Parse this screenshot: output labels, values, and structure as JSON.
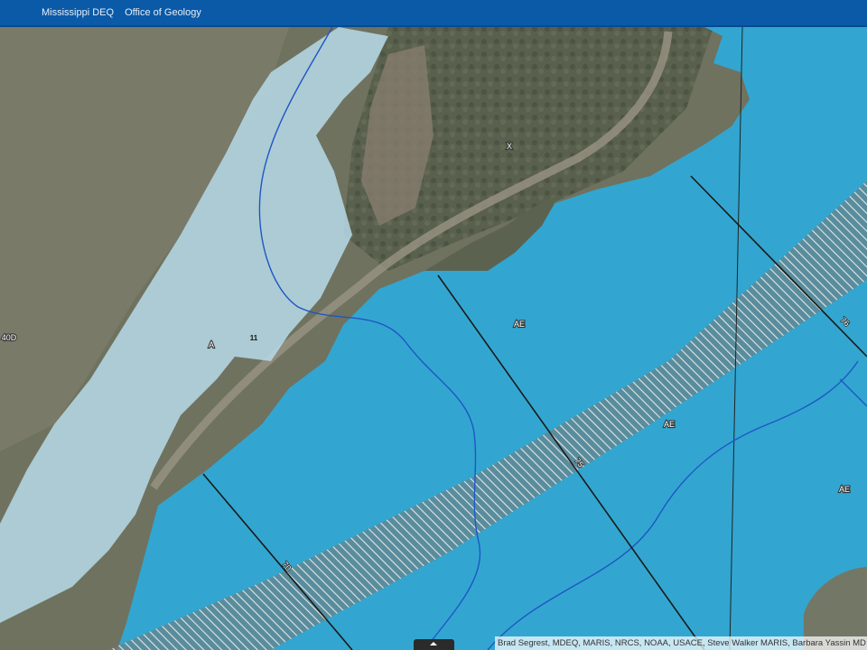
{
  "header": {
    "org_link": "Mississippi DEQ",
    "office_link": "Office of Geology"
  },
  "map": {
    "zone_labels": {
      "x": "X",
      "ae_center": "AE",
      "ae_band": "AE",
      "ae_right": "AE",
      "a_zone": "A"
    },
    "contour_label": "11",
    "left_edge_label": "40D",
    "section_labels": {
      "line_1": "70",
      "line_2": "75",
      "line_3": "76"
    },
    "colors": {
      "floodway_ae": "#2ea9d6",
      "zone_a": "#b7dbe9",
      "terrain": "#6b6f5f",
      "river": "#1f56c6",
      "cross_section": "#1a1a1a"
    }
  },
  "attribution": {
    "text": "Brad Segrest, MDEQ, MARIS, NRCS, NOAA, USACE, Steve Walker MARIS, Barbara Yassin MD"
  }
}
